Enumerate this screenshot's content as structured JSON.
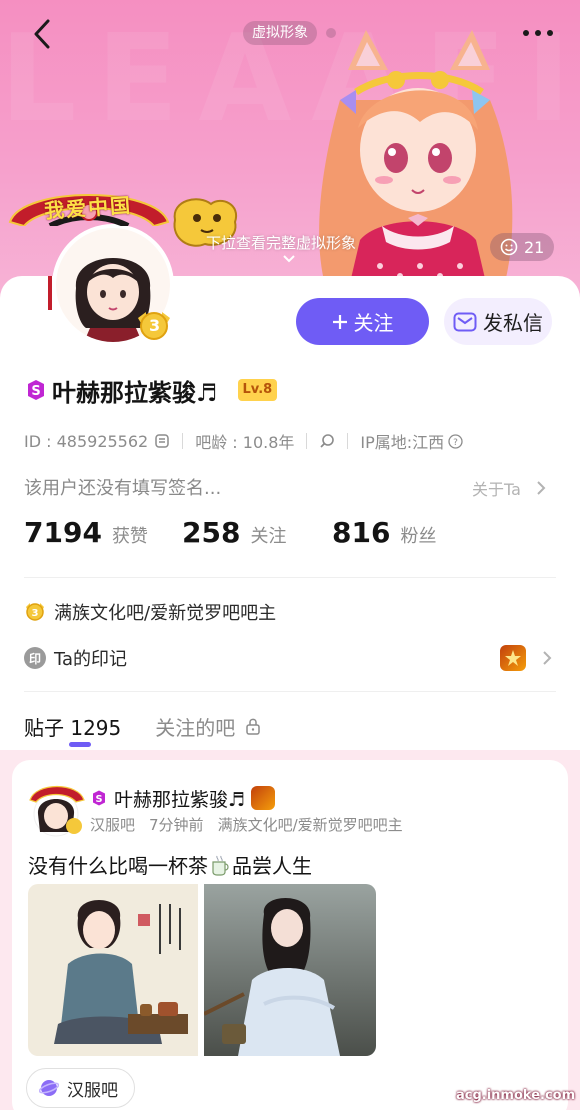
{
  "header": {
    "virtual_tag": "虚拟形象",
    "pull_hint": "下拉查看完整虚拟形象",
    "like_count": "21",
    "bg_letters": "LEAAFIU"
  },
  "actions": {
    "follow_label": "关注",
    "message_label": "发私信"
  },
  "profile": {
    "name": "叶赫那拉紫骏♬",
    "level": "Lv.8",
    "avatar_banner": "我爱中国",
    "avatar_level": "3",
    "id_text": "ID : 485925562",
    "age_text": "吧龄 : 10.8年",
    "ip_text": "IP属地:江西",
    "signature": "该用户还没有填写签名...",
    "about_link": "关于Ta"
  },
  "stats": [
    {
      "value": "7194",
      "label": "获赞"
    },
    {
      "value": "258",
      "label": "关注"
    },
    {
      "value": "816",
      "label": "粉丝"
    }
  ],
  "badges": {
    "owner_title": "满族文化吧/爱新觉罗吧吧主",
    "mark_label": "Ta的印记",
    "seal_char": "印"
  },
  "tabs": {
    "posts": "贴子 1295",
    "followed_bars": "关注的吧"
  },
  "post": {
    "author": "叶赫那拉紫骏♬",
    "forum": "汉服吧",
    "time": "7分钟前",
    "owner_title": "满族文化吧/爱新觉罗吧吧主",
    "text_before": "没有什么比喝一杯茶",
    "text_after": "品尝人生",
    "tag": "汉服吧"
  },
  "watermark": "acg.inmoke.com",
  "colors": {
    "accent": "#6f5cf5",
    "hero_pink": "#f58fc1",
    "level_gold": "#ffd24d"
  },
  "icons": [
    "back-icon",
    "more-icon",
    "smile-icon",
    "plus-icon",
    "envelope-icon",
    "copy-icon",
    "search-icon",
    "help-icon",
    "chevron-right-icon",
    "lock-icon",
    "tea-icon",
    "planet-icon"
  ]
}
